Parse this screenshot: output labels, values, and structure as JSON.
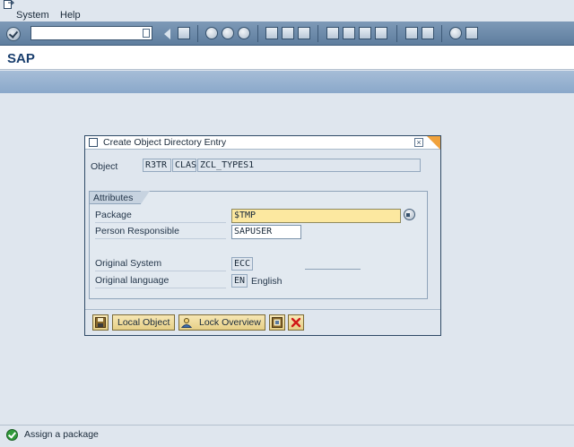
{
  "menu": {
    "items": [
      {
        "label": "System"
      },
      {
        "label": "Help"
      }
    ]
  },
  "toolbar": {
    "command_field_value": "",
    "icons": [
      "enter-check-icon",
      "save-icon",
      "back-icon",
      "exit-icon",
      "cancel-icon",
      "print-icon",
      "find-icon",
      "find-next-icon",
      "first-page-icon",
      "previous-page-icon",
      "next-page-icon",
      "last-page-icon",
      "create-session-icon",
      "shortcut-icon",
      "help-icon",
      "layout-icon"
    ]
  },
  "title_bar": {
    "title": "SAP"
  },
  "dialog": {
    "title": "Create Object Directory Entry",
    "object": {
      "label": "Object",
      "pgmid": "R3TR",
      "type": "CLAS",
      "name": "ZCL_TYPES1"
    },
    "attributes": {
      "group_title": "Attributes",
      "package": {
        "label": "Package",
        "value": "$TMP"
      },
      "person_responsible": {
        "label": "Person Responsible",
        "value": "SAPUSER"
      },
      "original_system": {
        "label": "Original System",
        "value": "ECC"
      },
      "original_language": {
        "label": "Original language",
        "code": "EN",
        "text": "English"
      }
    },
    "buttons": {
      "save_icon": "save-icon",
      "local_object": "Local Object",
      "lock_overview": "Lock Overview",
      "cancel_icon": "cancel-icon"
    }
  },
  "status_bar": {
    "message": "Assign a package",
    "type": "success"
  },
  "colors": {
    "toolbar": "#6a87a8",
    "app_bar": "#97b2d0",
    "title": "#1a3f6e",
    "required_field": "#fce8a0",
    "dialog_corner": "#f0a23c"
  }
}
